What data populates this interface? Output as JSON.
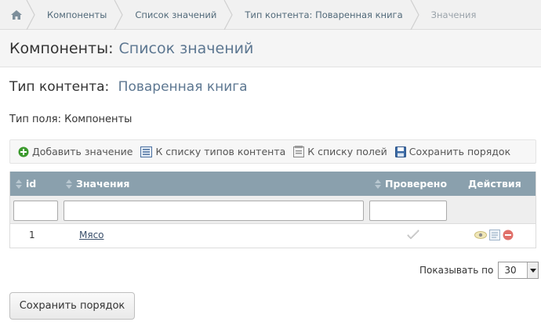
{
  "breadcrumb": {
    "items": [
      "Компоненты",
      "Список значений",
      "Тип контента: Поваренная книга",
      "Значения"
    ]
  },
  "page_header": {
    "prefix": "Компоненты:",
    "accent": "Список значений"
  },
  "content_type": {
    "prefix": "Тип контента:",
    "accent": "Поваренная книга"
  },
  "field_type": "Тип поля: Компоненты",
  "toolbar": {
    "add_value": "Добавить значение",
    "to_content_types": "К списку типов контента",
    "to_fields": "К списку полей",
    "save_order": "Сохранить порядок"
  },
  "table": {
    "headers": {
      "id": "id",
      "values": "Значения",
      "checked": "Проверено",
      "actions": "Действия"
    },
    "rows": [
      {
        "id": "1",
        "value": "Мясо"
      }
    ]
  },
  "pager": {
    "label": "Показывать по",
    "per_page": "30"
  },
  "save_button": "Сохранить порядок",
  "colors": {
    "accent": "#5d7791",
    "table_header": "#8aa0ad",
    "add_icon": "#3c9a2e",
    "delete_icon": "#e0706a"
  }
}
